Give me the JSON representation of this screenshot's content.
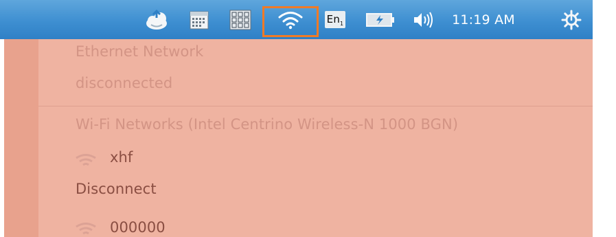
{
  "panel": {
    "indicators": [
      {
        "id": "sync",
        "icon": "cloud-sync-icon"
      },
      {
        "id": "calendar",
        "icon": "calendar-icon"
      },
      {
        "id": "keypad",
        "icon": "keypad-icon"
      },
      {
        "id": "network",
        "icon": "wifi-icon",
        "highlighted": true
      },
      {
        "id": "keyboard",
        "icon": "keyboard-layout-icon",
        "label": "En",
        "sub": "1"
      },
      {
        "id": "battery",
        "icon": "battery-charging-icon"
      },
      {
        "id": "sound",
        "icon": "speaker-icon"
      },
      {
        "id": "session",
        "icon": "power-gear-icon"
      }
    ],
    "clock": "11:19 AM",
    "colors": {
      "panel_top": "#5fa6dc",
      "panel_bottom": "#2f80c6",
      "highlight": "#f07a26"
    }
  },
  "menu": {
    "ethernet_header": "Ethernet Network",
    "ethernet_status": "disconnected",
    "wifi_header": "Wi-Fi Networks (Intel Centrino Wireless-N 1000 BGN)",
    "networks": [
      {
        "ssid": "xhf",
        "icon": "wifi-signal-icon"
      },
      {
        "ssid": "000000",
        "icon": "wifi-signal-icon"
      }
    ],
    "disconnect_label": "Disconnect",
    "colors": {
      "background": "#efb3a1",
      "strip": "#e8a28d",
      "dim_text": "#d39485",
      "active_text": "#8a4e42"
    }
  }
}
